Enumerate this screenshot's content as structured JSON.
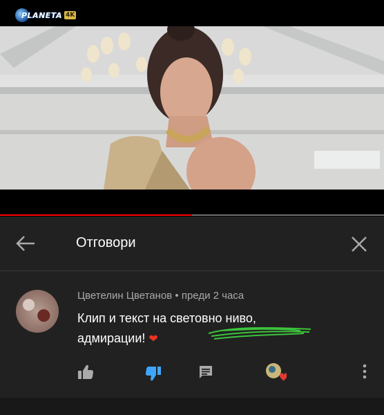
{
  "video": {
    "logo_text": "PLANETA",
    "logo_badge": "4K",
    "progress_percent": 50
  },
  "header": {
    "title": "Отговори"
  },
  "comment": {
    "author": "Цветелин Цветанов",
    "time": "• преди 2 часа",
    "text_line1": "Клип и текст на световно ниво,",
    "text_line2": "адмирации!",
    "emoji": "❤"
  },
  "colors": {
    "progress": "#ff0000",
    "panel_bg": "#212121",
    "dislike_active": "#3ea6ff",
    "heart": "#e53935"
  },
  "icons": [
    "back-arrow-icon",
    "close-icon",
    "thumb-up-icon",
    "thumb-down-icon",
    "reply-icon",
    "creator-heart-icon",
    "more-options-icon"
  ]
}
